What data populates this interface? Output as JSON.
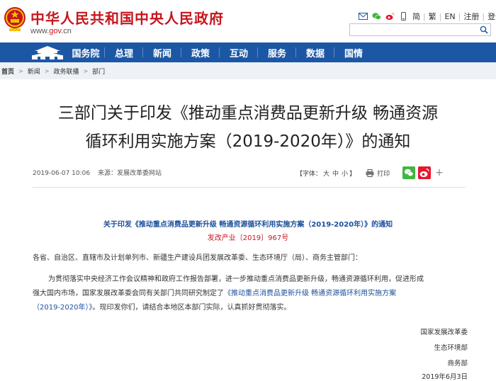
{
  "header": {
    "site_title": "中华人民共和国中央人民政府",
    "site_url_prefix": "www.",
    "site_url_domain": "gov",
    "site_url_suffix": ".cn",
    "tools": {
      "simplified": "简",
      "traditional": "繁",
      "english": "EN",
      "register": "注册",
      "login": "登录"
    },
    "search_placeholder": ""
  },
  "nav": {
    "items": [
      "国务院",
      "总理",
      "新闻",
      "政策",
      "互动",
      "服务",
      "数据",
      "国情"
    ]
  },
  "breadcrumb": [
    "首页",
    "新闻",
    "政务联播",
    "部门"
  ],
  "article": {
    "title_line1": "三部门关于印发《推动重点消费品更新升级 畅通资源",
    "title_line2": "循环利用实施方案（2019-2020年）》的通知",
    "date": "2019-06-07 10:06",
    "source_label": "来源：",
    "source": "发展改革委网站",
    "font_label": "【字体：",
    "font_large": "大",
    "font_medium": "中",
    "font_small": "小",
    "font_close": "】",
    "print_label": "打印",
    "plus": "+",
    "doc_heading": "关于印发《推动重点消费品更新升级 畅通资源循环利用实施方案（2019-2020年）》的通知",
    "doc_number": "发改产业〔2019〕967号",
    "addressee": "各省、自治区、直辖市及计划单列市、新疆生产建设兵团发展改革委、生态环境厅（局）、商务主管部门：",
    "body_line1": "为贯彻落实中央经济工作会议精神和政府工作报告部署，进一步推动重点消费品更新升级，畅通资源循环利用，促进形成",
    "body_line2_text": "强大国内市场，国家发展改革委会同有关部门共同研究制定了",
    "body_line2_link": "《推动重点消费品更新升级 畅通资源循环利用实施方案",
    "body_line3_link": "（2019-2020年）》",
    "body_line3_text": "。现印发你们，请结合本地区本部门实际，认真抓好贯彻落实。",
    "signatures": [
      "国家发展改革委",
      "生态环境部",
      "商务部"
    ],
    "sign_date": "2019年6月3日"
  },
  "colors": {
    "brand_red": "#c8161d",
    "nav_blue": "#1c57a5",
    "link_blue": "#1c4f9c",
    "wechat_green": "#3fb83f",
    "weibo_red": "#e6162d"
  }
}
